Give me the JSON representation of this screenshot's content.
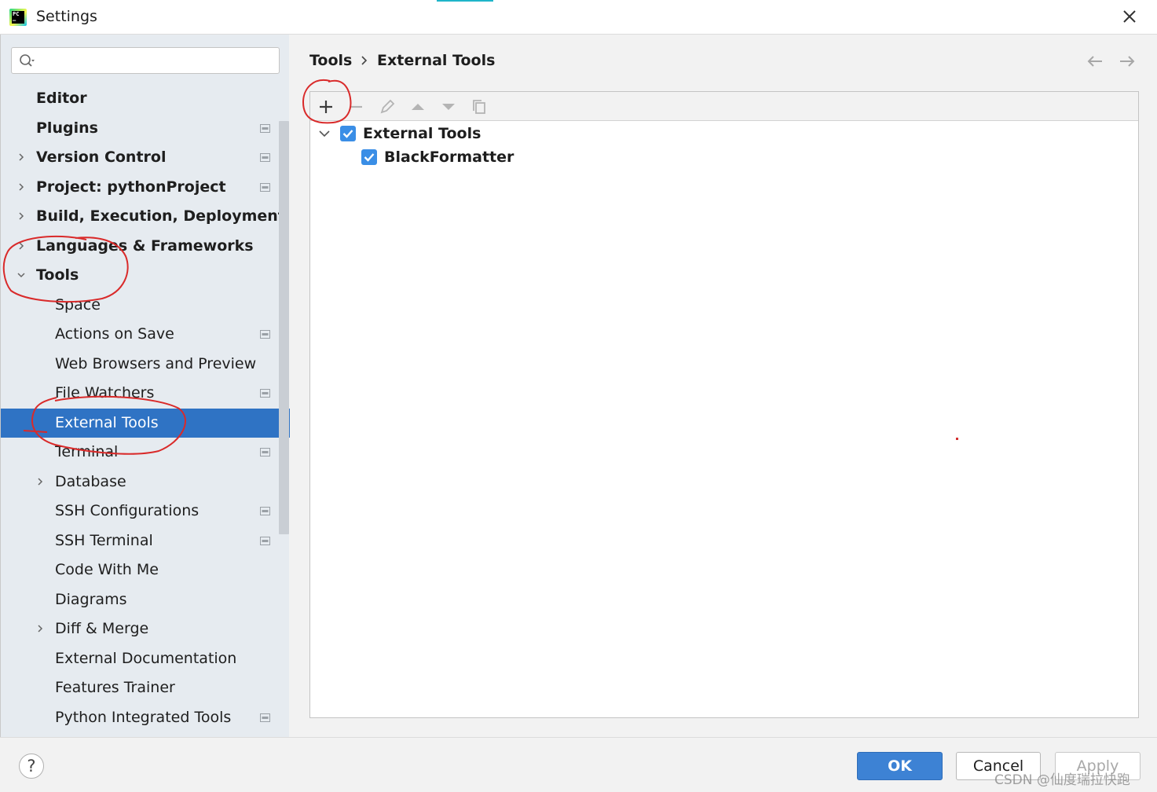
{
  "window": {
    "title": "Settings"
  },
  "search": {
    "placeholder": "",
    "value": ""
  },
  "sidebar": {
    "items": [
      {
        "label": "Editor",
        "level": 0,
        "chevron": "none",
        "project_icon": false,
        "selected": false
      },
      {
        "label": "Plugins",
        "level": 0,
        "chevron": "none",
        "project_icon": true,
        "selected": false
      },
      {
        "label": "Version Control",
        "level": 0,
        "chevron": "right",
        "project_icon": true,
        "selected": false
      },
      {
        "label": "Project: pythonProject",
        "level": 0,
        "chevron": "right",
        "project_icon": true,
        "selected": false
      },
      {
        "label": "Build, Execution, Deployment",
        "level": 0,
        "chevron": "right",
        "project_icon": false,
        "selected": false
      },
      {
        "label": "Languages & Frameworks",
        "level": 0,
        "chevron": "right",
        "project_icon": false,
        "selected": false
      },
      {
        "label": "Tools",
        "level": 0,
        "chevron": "down",
        "project_icon": false,
        "selected": false
      },
      {
        "label": "Space",
        "level": 1,
        "chevron": "none",
        "project_icon": false,
        "selected": false
      },
      {
        "label": "Actions on Save",
        "level": 1,
        "chevron": "none",
        "project_icon": true,
        "selected": false
      },
      {
        "label": "Web Browsers and Preview",
        "level": 1,
        "chevron": "none",
        "project_icon": false,
        "selected": false
      },
      {
        "label": "File Watchers",
        "level": 1,
        "chevron": "none",
        "project_icon": true,
        "selected": false
      },
      {
        "label": "External Tools",
        "level": 1,
        "chevron": "none",
        "project_icon": false,
        "selected": true
      },
      {
        "label": "Terminal",
        "level": 1,
        "chevron": "none",
        "project_icon": true,
        "selected": false
      },
      {
        "label": "Database",
        "level": 1,
        "chevron": "right",
        "project_icon": false,
        "selected": false
      },
      {
        "label": "SSH Configurations",
        "level": 1,
        "chevron": "none",
        "project_icon": true,
        "selected": false
      },
      {
        "label": "SSH Terminal",
        "level": 1,
        "chevron": "none",
        "project_icon": true,
        "selected": false
      },
      {
        "label": "Code With Me",
        "level": 1,
        "chevron": "none",
        "project_icon": false,
        "selected": false
      },
      {
        "label": "Diagrams",
        "level": 1,
        "chevron": "none",
        "project_icon": false,
        "selected": false
      },
      {
        "label": "Diff & Merge",
        "level": 1,
        "chevron": "right",
        "project_icon": false,
        "selected": false
      },
      {
        "label": "External Documentation",
        "level": 1,
        "chevron": "none",
        "project_icon": false,
        "selected": false
      },
      {
        "label": "Features Trainer",
        "level": 1,
        "chevron": "none",
        "project_icon": false,
        "selected": false
      },
      {
        "label": "Python Integrated Tools",
        "level": 1,
        "chevron": "none",
        "project_icon": true,
        "selected": false
      }
    ]
  },
  "breadcrumb": {
    "parent": "Tools",
    "current": "External Tools"
  },
  "toolbar": {
    "buttons": [
      "add-icon",
      "remove-icon",
      "edit-icon",
      "move-up-icon",
      "move-down-icon",
      "copy-icon"
    ]
  },
  "tools_tree": [
    {
      "label": "External Tools",
      "checked": true,
      "expanded": true
    },
    {
      "label": "BlackFormatter",
      "checked": true
    }
  ],
  "footer": {
    "ok_label": "OK",
    "cancel_label": "Cancel",
    "apply_label": "Apply",
    "help_label": "?"
  },
  "watermark": "CSDN @仙度瑞拉快跑",
  "colors": {
    "selection": "#2f73c4",
    "checkbox": "#3a8ee6",
    "ok_button": "#3d82d4",
    "annotation": "#d32f2f"
  }
}
